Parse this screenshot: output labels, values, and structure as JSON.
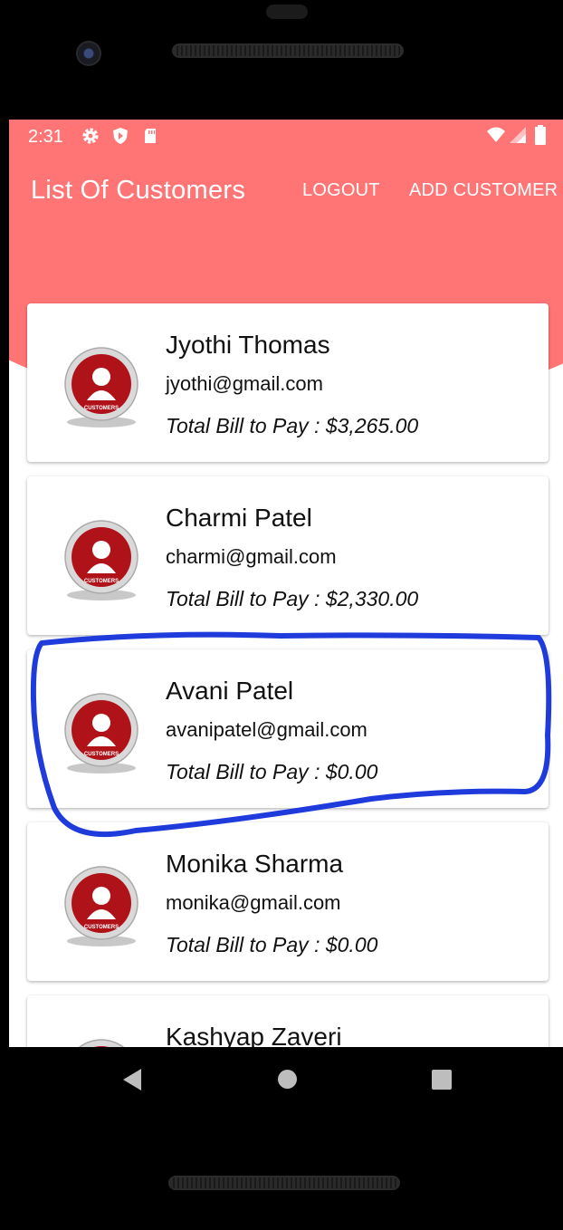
{
  "status_bar": {
    "time": "2:31",
    "left_icons": [
      "gear-icon",
      "shield-icon",
      "sd-card-icon"
    ],
    "right_icons": [
      "wifi-icon",
      "signal-icon",
      "battery-icon"
    ]
  },
  "toolbar": {
    "title": "List Of Customers",
    "logout_label": "LOGOUT",
    "add_customer_label": "ADD CUSTOMER"
  },
  "customers": [
    {
      "name": "Jyothi Thomas",
      "email": "jyothi@gmail.com",
      "bill": "Total Bill to Pay : $3,265.00"
    },
    {
      "name": "Charmi Patel",
      "email": "charmi@gmail.com",
      "bill": "Total Bill to Pay : $2,330.00"
    },
    {
      "name": "Avani Patel",
      "email": "avanipatel@gmail.com",
      "bill": "Total Bill to Pay : $0.00"
    },
    {
      "name": "Monika Sharma",
      "email": "monika@gmail.com",
      "bill": "Total Bill to Pay : $0.00"
    },
    {
      "name": "Kashyap Zaveri",
      "email": "",
      "bill": ""
    }
  ],
  "avatar": {
    "icon": "customers-badge-icon",
    "label": "CUSTOMERS"
  },
  "colors": {
    "header": "#ff7575",
    "highlight": "#1f3bdc",
    "badge_red": "#b0121a"
  },
  "nav_bar": {
    "icons": [
      "back-icon",
      "home-icon",
      "recents-icon"
    ]
  }
}
